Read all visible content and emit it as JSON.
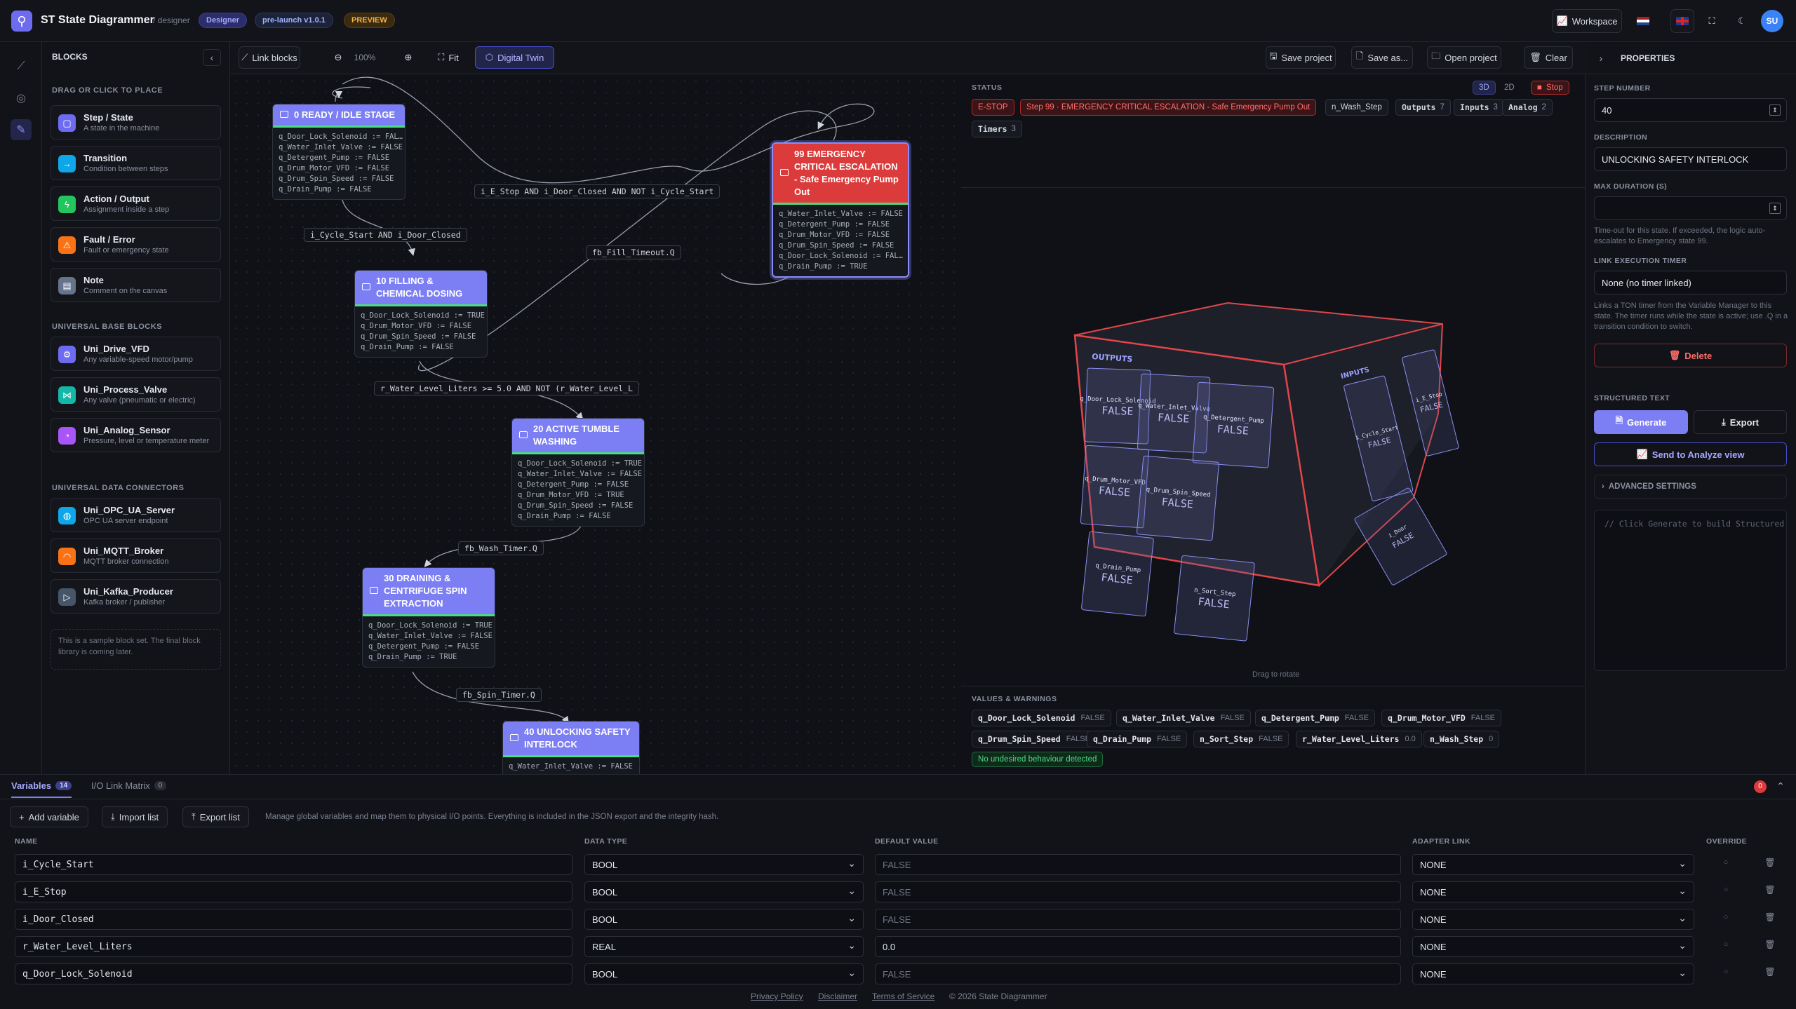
{
  "app": {
    "title": "ST State Diagrammer",
    "subtitle": "/ designer",
    "badge_designer": "Designer",
    "badge_version": "pre-launch v1.0.1",
    "badge_preview": "PREVIEW",
    "workspace_label": "Workspace",
    "avatar": "SU"
  },
  "blocks": {
    "title": "BLOCKS",
    "section_place": "DRAG OR CLICK TO PLACE",
    "items": [
      {
        "title": "Step / State",
        "sub": "A state in the machine",
        "icon": "square-icon",
        "color": "#6d6cf0"
      },
      {
        "title": "Transition",
        "sub": "Condition between steps",
        "icon": "arrow-icon",
        "color": "#0ea5e9"
      },
      {
        "title": "Action / Output",
        "sub": "Assignment inside a step",
        "icon": "bolt-icon",
        "color": "#22c55e"
      },
      {
        "title": "Fault / Error",
        "sub": "Fault or emergency state",
        "icon": "warning-icon",
        "color": "#f97316"
      },
      {
        "title": "Note",
        "sub": "Comment on the canvas",
        "icon": "note-icon",
        "color": "#64748b"
      }
    ],
    "section_base": "UNIVERSAL BASE BLOCKS",
    "base": [
      {
        "title": "Uni_Drive_VFD",
        "sub": "Any variable-speed motor/pump",
        "icon": "gear-icon",
        "color": "#6d6cf0"
      },
      {
        "title": "Uni_Process_Valve",
        "sub": "Any valve (pneumatic or electric)",
        "icon": "valve-icon",
        "color": "#14b8a6"
      },
      {
        "title": "Uni_Analog_Sensor",
        "sub": "Pressure, level or temperature meter",
        "icon": "gauge-icon",
        "color": "#a855f7"
      }
    ],
    "section_connectors": "UNIVERSAL DATA CONNECTORS",
    "connectors": [
      {
        "title": "Uni_OPC_UA_Server",
        "sub": "OPC UA server endpoint",
        "icon": "globe-icon",
        "color": "#0ea5e9"
      },
      {
        "title": "Uni_MQTT_Broker",
        "sub": "MQTT broker connection",
        "icon": "broker-icon",
        "color": "#f97316"
      },
      {
        "title": "Uni_Kafka_Producer",
        "sub": "Kafka broker / publisher",
        "icon": "send-icon",
        "color": "#475569"
      }
    ],
    "note": "This is a sample block set. The final block library is coming later."
  },
  "canvas": {
    "toolbar": {
      "link_blocks": "Link blocks",
      "zoom": "100%",
      "fit": "Fit",
      "digital_twin": "Digital Twin"
    },
    "nodes": [
      {
        "id": "n0",
        "title": "0 READY / IDLE STAGE",
        "lines": [
          "q_Door_Lock_Solenoid := FAL…",
          "q_Water_Inlet_Valve := FALSE",
          "q_Detergent_Pump := FALSE",
          "q_Drum_Motor_VFD := FALSE",
          "q_Drum_Spin_Speed := FALSE",
          "q_Drain_Pump := FALSE"
        ]
      },
      {
        "id": "n10",
        "title": "10 FILLING & CHEMICAL DOSING",
        "lines": [
          "q_Door_Lock_Solenoid := TRUE",
          "q_Drum_Motor_VFD := FALSE",
          "q_Drum_Spin_Speed := FALSE",
          "q_Drain_Pump := FALSE"
        ]
      },
      {
        "id": "n20",
        "title": "20 ACTIVE TUMBLE WASHING",
        "lines": [
          "q_Door_Lock_Solenoid := TRUE",
          "q_Water_Inlet_Valve := FALSE",
          "q_Detergent_Pump := FALSE",
          "q_Drum_Motor_VFD := TRUE",
          "q_Drum_Spin_Speed := FALSE",
          "q_Drain_Pump := FALSE"
        ]
      },
      {
        "id": "n30",
        "title": "30 DRAINING & CENTRIFUGE SPIN EXTRACTION",
        "lines": [
          "q_Door_Lock_Solenoid := TRUE",
          "q_Water_Inlet_Valve := FALSE",
          "q_Detergent_Pump := FALSE",
          "q_Drain_Pump := TRUE"
        ]
      },
      {
        "id": "n40",
        "title": "40 UNLOCKING SAFETY INTERLOCK",
        "lines": [
          "q_Water_Inlet_Valve := FALSE"
        ]
      },
      {
        "id": "n99",
        "title": "99 EMERGENCY CRITICAL ESCALATION - Safe Emergency Pump Out",
        "lines": [
          "q_Water_Inlet_Valve := FALSE",
          "q_Detergent_Pump := FALSE",
          "q_Drum_Motor_VFD := FALSE",
          "q_Drum_Spin_Speed := FALSE",
          "q_Door_Lock_Solenoid := FAL…",
          "q_Drain_Pump := TRUE"
        ]
      }
    ],
    "edges": [
      "i_Cycle_Start AND i_Door_Closed",
      "i_E_Stop AND i_Door_Closed AND NOT i_Cycle_Start",
      "fb_Fill_Timeout.Q",
      "r_Water_Level_Liters >= 5.0 AND NOT (r_Water_Level_L",
      "fb_Wash_Timer.Q",
      "fb_Spin_Timer.Q"
    ]
  },
  "top_actions": {
    "save": "Save project",
    "save_as": "Save as...",
    "open": "Open project",
    "clear": "Clear"
  },
  "twin": {
    "status_label": "STATUS",
    "view_3d": "3D",
    "view_2d": "2D",
    "stop": "Stop",
    "estop": "E-STOP",
    "active_step": "Step 99 · EMERGENCY CRITICAL ESCALATION - Safe Emergency Pump Out",
    "wash_step": "n_Wash_Step",
    "counters": [
      {
        "label": "Outputs",
        "value": "7"
      },
      {
        "label": "Inputs",
        "value": "3"
      },
      {
        "label": "Analog",
        "value": "2"
      },
      {
        "label": "Timers",
        "value": "3"
      }
    ],
    "cube_outputs_label": "OUTPUTS",
    "cube_inputs_label": "INPUTS",
    "cube_cells": [
      {
        "name": "q_Door_Lock_Solenoid",
        "value": "FALSE"
      },
      {
        "name": "q_Water_Inlet_Valve",
        "value": "FALSE"
      },
      {
        "name": "q_Detergent_Pump",
        "value": "FALSE"
      },
      {
        "name": "q_Drum_Motor_VFD",
        "value": "FALSE"
      },
      {
        "name": "q_Drum_Spin_Speed",
        "value": "FALSE"
      },
      {
        "name": "q_Drain_Pump",
        "value": "FALSE"
      },
      {
        "name": "n_Sort_Step",
        "value": "FALSE"
      }
    ],
    "cube_inputs": [
      {
        "name": "i_Cycle_Start",
        "value": "FALSE"
      },
      {
        "name": "i_E_Stop",
        "value": "FALSE"
      },
      {
        "name": "i_Door",
        "value": "FALSE"
      }
    ],
    "drag_hint": "Drag to rotate",
    "values_label": "VALUES & WARNINGS",
    "values": [
      {
        "name": "q_Door_Lock_Solenoid",
        "value": "FALSE"
      },
      {
        "name": "q_Water_Inlet_Valve",
        "value": "FALSE"
      },
      {
        "name": "q_Detergent_Pump",
        "value": "FALSE"
      },
      {
        "name": "q_Drum_Motor_VFD",
        "value": "FALSE"
      },
      {
        "name": "q_Drum_Spin_Speed",
        "value": "FALSE"
      },
      {
        "name": "q_Drain_Pump",
        "value": "FALSE"
      },
      {
        "name": "n_Sort_Step",
        "value": "FALSE"
      },
      {
        "name": "r_Water_Level_Liters",
        "value": "0.0"
      },
      {
        "name": "n_Wash_Step",
        "value": "0"
      }
    ],
    "ok_message": "No undesired behaviour detected"
  },
  "props": {
    "title": "PROPERTIES",
    "step_number_label": "STEP NUMBER",
    "step_number": "40",
    "description_label": "DESCRIPTION",
    "description": "UNLOCKING SAFETY INTERLOCK",
    "max_duration_label": "MAX DURATION (S)",
    "max_duration": "",
    "max_duration_help": "Time-out for this state. If exceeded, the logic auto-escalates to Emergency state 99.",
    "timer_label": "LINK EXECUTION TIMER",
    "timer_value": "None (no timer linked)",
    "timer_help": "Links a TON timer from the Variable Manager to this state. The timer runs while the state is active; use .Q in a transition condition to switch.",
    "delete": "Delete",
    "structured_label": "STRUCTURED TEXT",
    "generate": "Generate",
    "export": "Export",
    "send_analyze": "Send to Analyze view",
    "advanced": "ADVANCED SETTINGS",
    "code_placeholder": "// Click Generate to build Structured Text"
  },
  "variables": {
    "tab_variables": "Variables",
    "tab_variables_count": "14",
    "tab_io": "I/O Link Matrix",
    "tab_io_count": "0",
    "error_count": "0",
    "add": "Add variable",
    "import": "Import list",
    "export": "Export list",
    "help": "Manage global variables and map them to physical I/O points. Everything is included in the JSON export and the integrity hash.",
    "columns": {
      "name": "NAME",
      "type": "DATA TYPE",
      "default": "DEFAULT VALUE",
      "adapter": "ADAPTER LINK",
      "override": "OVERRIDE"
    },
    "rows": [
      {
        "name": "i_Cycle_Start",
        "type": "BOOL",
        "default": "",
        "placeholder": "FALSE",
        "adapter": "NONE"
      },
      {
        "name": "i_E_Stop",
        "type": "BOOL",
        "default": "",
        "placeholder": "FALSE",
        "adapter": "NONE"
      },
      {
        "name": "i_Door_Closed",
        "type": "BOOL",
        "default": "",
        "placeholder": "FALSE",
        "adapter": "NONE"
      },
      {
        "name": "r_Water_Level_Liters",
        "type": "REAL",
        "default": "0.0",
        "placeholder": "",
        "adapter": "NONE"
      },
      {
        "name": "q_Door_Lock_Solenoid",
        "type": "BOOL",
        "default": "",
        "placeholder": "FALSE",
        "adapter": "NONE"
      }
    ]
  },
  "footer": {
    "privacy": "Privacy Policy",
    "disclaimer": "Disclaimer",
    "terms": "Terms of Service",
    "copyright": "© 2026 State Diagrammer"
  }
}
